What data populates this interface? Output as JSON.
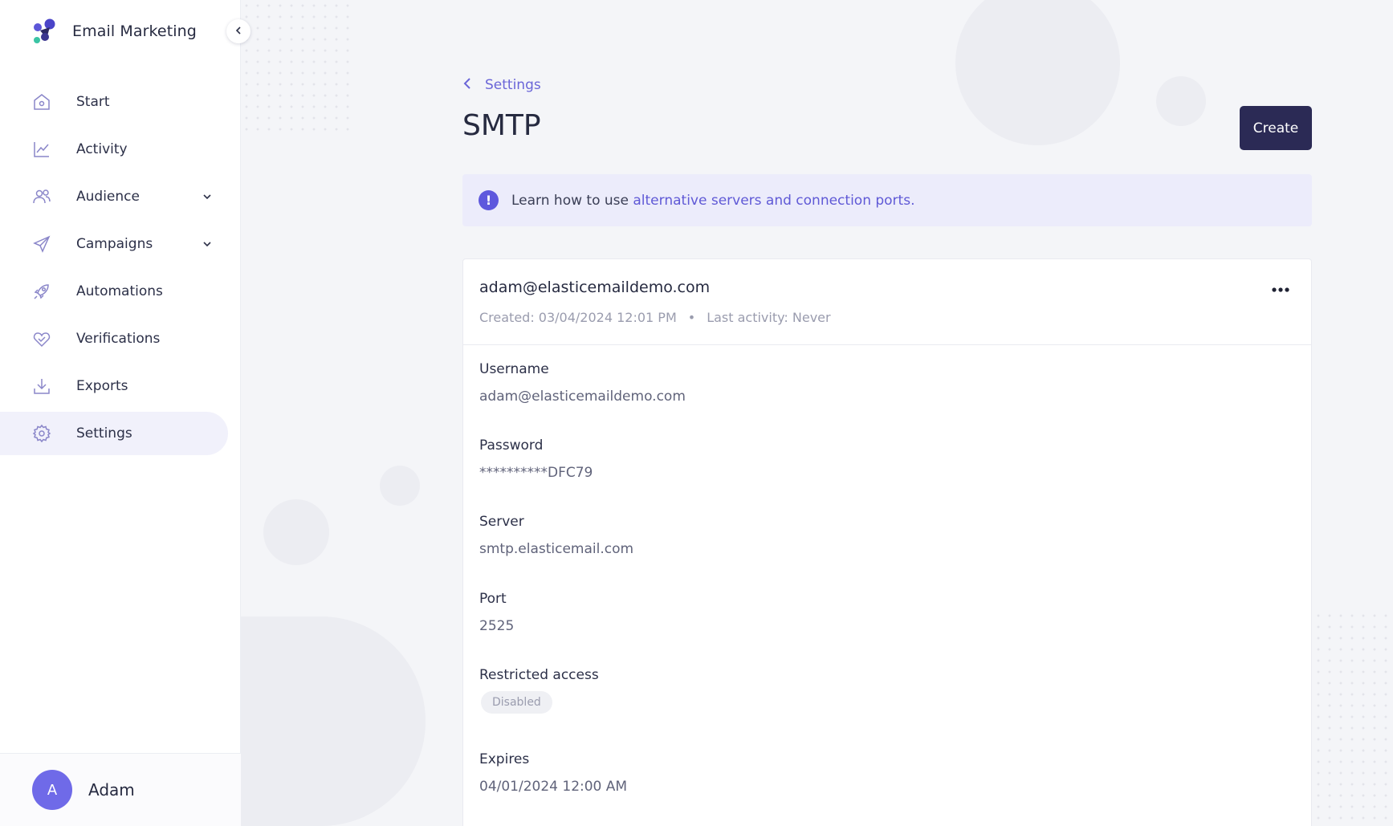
{
  "brand": {
    "name": "Email Marketing"
  },
  "sidebar": {
    "items": [
      {
        "label": "Start",
        "icon": "home-icon",
        "active": false,
        "expandable": false
      },
      {
        "label": "Activity",
        "icon": "chart-line-icon",
        "active": false,
        "expandable": false
      },
      {
        "label": "Audience",
        "icon": "users-icon",
        "active": false,
        "expandable": true
      },
      {
        "label": "Campaigns",
        "icon": "paper-plane-icon",
        "active": false,
        "expandable": true
      },
      {
        "label": "Automations",
        "icon": "rocket-icon",
        "active": false,
        "expandable": false
      },
      {
        "label": "Verifications",
        "icon": "heart-check-icon",
        "active": false,
        "expandable": false
      },
      {
        "label": "Exports",
        "icon": "download-icon",
        "active": false,
        "expandable": false
      },
      {
        "label": "Settings",
        "icon": "gear-icon",
        "active": true,
        "expandable": false
      }
    ]
  },
  "user": {
    "initial": "A",
    "name": "Adam"
  },
  "breadcrumb": {
    "back_label": "Settings"
  },
  "page": {
    "title": "SMTP",
    "create_label": "Create"
  },
  "info": {
    "text": "Learn how to use ",
    "link_text": "alternative servers and connection ports."
  },
  "credential": {
    "title": "adam@elasticemaildemo.com",
    "created": "Created: 03/04/2024 12:01 PM",
    "separator": "•",
    "last_activity": "Last activity: Never",
    "fields": {
      "username": {
        "label": "Username",
        "value": "adam@elasticemaildemo.com"
      },
      "password": {
        "label": "Password",
        "value": "**********DFC79"
      },
      "server": {
        "label": "Server",
        "value": "smtp.elasticemail.com"
      },
      "port": {
        "label": "Port",
        "value": "2525"
      },
      "restricted": {
        "label": "Restricted access",
        "value": "Disabled"
      },
      "expires": {
        "label": "Expires",
        "value": "04/01/2024 12:00 AM"
      }
    }
  },
  "colors": {
    "accent": "#5e58dd",
    "primary_button": "#2b2a55",
    "info_background": "#ececfb",
    "active_nav": "#f1f1fb"
  }
}
